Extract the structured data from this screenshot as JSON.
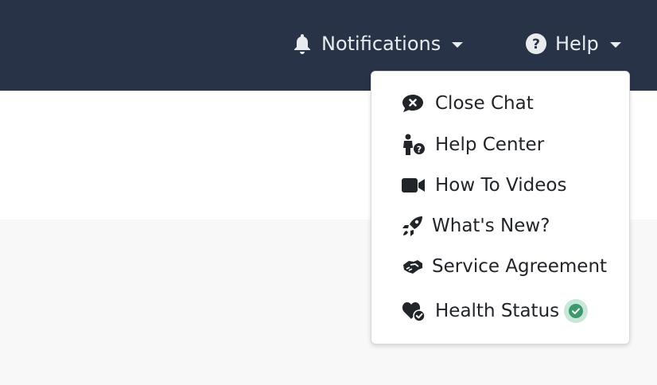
{
  "header": {
    "notifications": {
      "label": "Notifications",
      "icon": "bell-icon"
    },
    "help": {
      "label": "Help",
      "icon": "question-circle-icon"
    }
  },
  "help_menu": {
    "items": [
      {
        "label": "Close Chat",
        "icon": "comment-close-icon"
      },
      {
        "label": "Help Center",
        "icon": "person-question-icon"
      },
      {
        "label": "How To Videos",
        "icon": "video-camera-icon"
      },
      {
        "label": "What's New?",
        "icon": "rocket-icon"
      },
      {
        "label": "Service Agreement",
        "icon": "handshake-icon"
      },
      {
        "label": "Health Status",
        "icon": "heart-check-icon",
        "status_icon": "check-circle-icon",
        "status_color": "#3c9a6e"
      }
    ]
  },
  "colors": {
    "header_bg": "#283347",
    "header_text": "#e9ecef",
    "page_bg": "#f8f8f8",
    "status_ok": "#3c9a6e"
  }
}
